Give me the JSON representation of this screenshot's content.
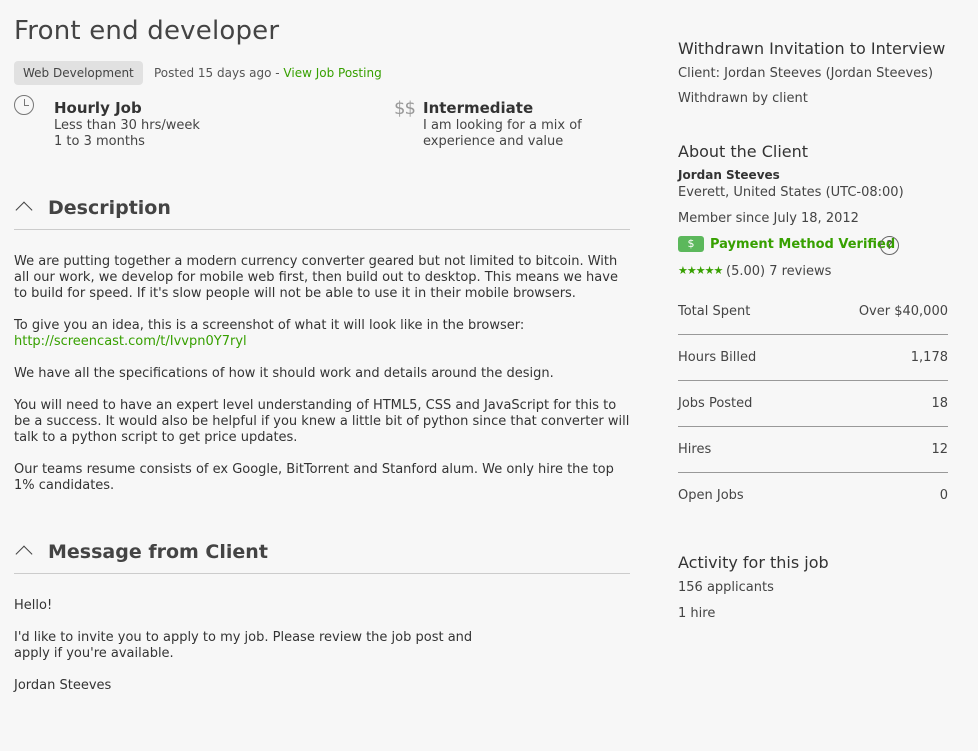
{
  "job": {
    "title": "Front end developer",
    "category_tag": "Web Development",
    "posted": "Posted 15 days ago - ",
    "view_link": "View Job Posting",
    "hourly": {
      "title": "Hourly Job",
      "line1": "Less than 30 hrs/week",
      "line2": "1 to 3 months",
      "icon": "clock-icon"
    },
    "level": {
      "icon_text": "$$",
      "title": "Intermediate",
      "line1": "I am looking for a mix of",
      "line2": "experience and value"
    }
  },
  "description": {
    "heading": "Description",
    "p1": "We are putting together a modern currency converter geared but not limited to bitcoin. With all our work, we develop for mobile web first, then build out to desktop. This means we have to build for speed. If it's slow people will not be able to use it in their mobile browsers.",
    "p2": "To give you an idea, this is a screenshot of what it will look like in the browser:",
    "link": "http://screencast.com/t/Ivvpn0Y7ryl",
    "p3": "We have all the specifications of how it should work and details around the design.",
    "p4": "You will need to have an expert level understanding of HTML5, CSS and JavaScript for this to be a success. It would also be helpful if you knew a little bit of python since that converter will talk to a python script to get price updates.",
    "p5": "Our teams resume consists of ex Google, BitTorrent and Stanford alum. We only hire the top 1% candidates."
  },
  "message": {
    "heading": "Message from Client",
    "greeting": "Hello!",
    "line1": "I'd like to invite you to apply to my job. Please review the job post and",
    "line2": "apply if you're available.",
    "signature": "Jordan Steeves"
  },
  "invitation": {
    "title": "Withdrawn Invitation to Interview",
    "client": "Client: Jordan Steeves (Jordan Steeves)",
    "status": "Withdrawn by client"
  },
  "client": {
    "heading": "About the Client",
    "name": "Jordan Steeves",
    "location": "Everett, United States (UTC-08:00)",
    "member_since": "Member since July 18, 2012",
    "payment_badge": "$",
    "payment_verified": "Payment Method Verified",
    "help_icon": "?",
    "stars": "★★★★★",
    "rating_value": 5.0,
    "rating": "(5.00) 7 reviews",
    "stats": [
      {
        "label": "Total Spent",
        "value": "Over $40,000"
      },
      {
        "label": "Hours Billed",
        "value": "1,178"
      },
      {
        "label": "Jobs Posted",
        "value": "18"
      },
      {
        "label": "Hires",
        "value": "12"
      },
      {
        "label": "Open Jobs",
        "value": "0"
      }
    ]
  },
  "activity": {
    "heading": "Activity for this job",
    "applicants": "156 applicants",
    "hires": "1 hire"
  }
}
